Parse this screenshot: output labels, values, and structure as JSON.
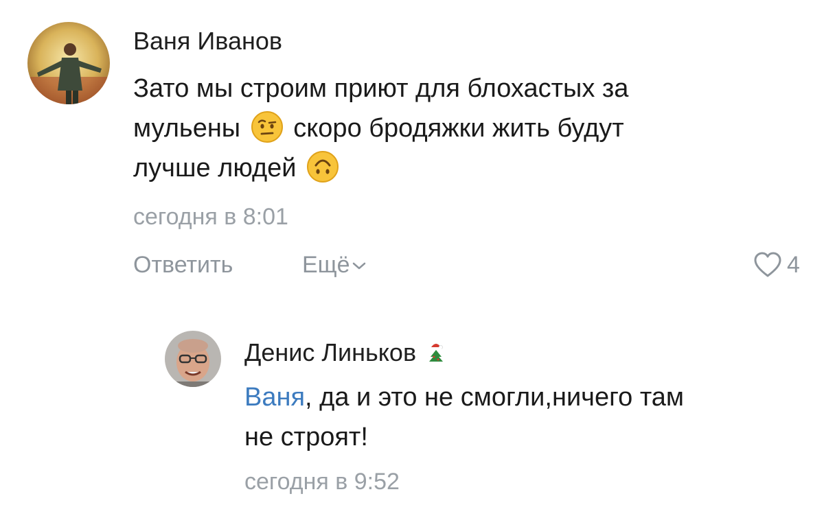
{
  "comment": {
    "author": "Ваня Иванов",
    "text_line1": "Зато мы строим приют для блохастых за",
    "text_line2_a": "мульены",
    "text_line2_b": "скоро бродяжки жить будут",
    "text_line3": "лучше людей",
    "emoji1": "raised-eyebrow-emoji",
    "emoji2": "upside-down-face-emoji",
    "timestamp": "сегодня в 8:01",
    "reply_label": "Ответить",
    "more_label": "Ещё",
    "likes": "4"
  },
  "reply": {
    "author": "Денис Линьков",
    "author_badge": "christmas-tree-badge-icon",
    "mention": "Ваня",
    "text_line1": ", да и это не смогли,ничего там",
    "text_line2": "не строят!",
    "timestamp": "сегодня в 9:52"
  },
  "colors": {
    "mention": "#3c7bbf",
    "meta": "#9aa0a6",
    "text": "#1a1a1a"
  }
}
